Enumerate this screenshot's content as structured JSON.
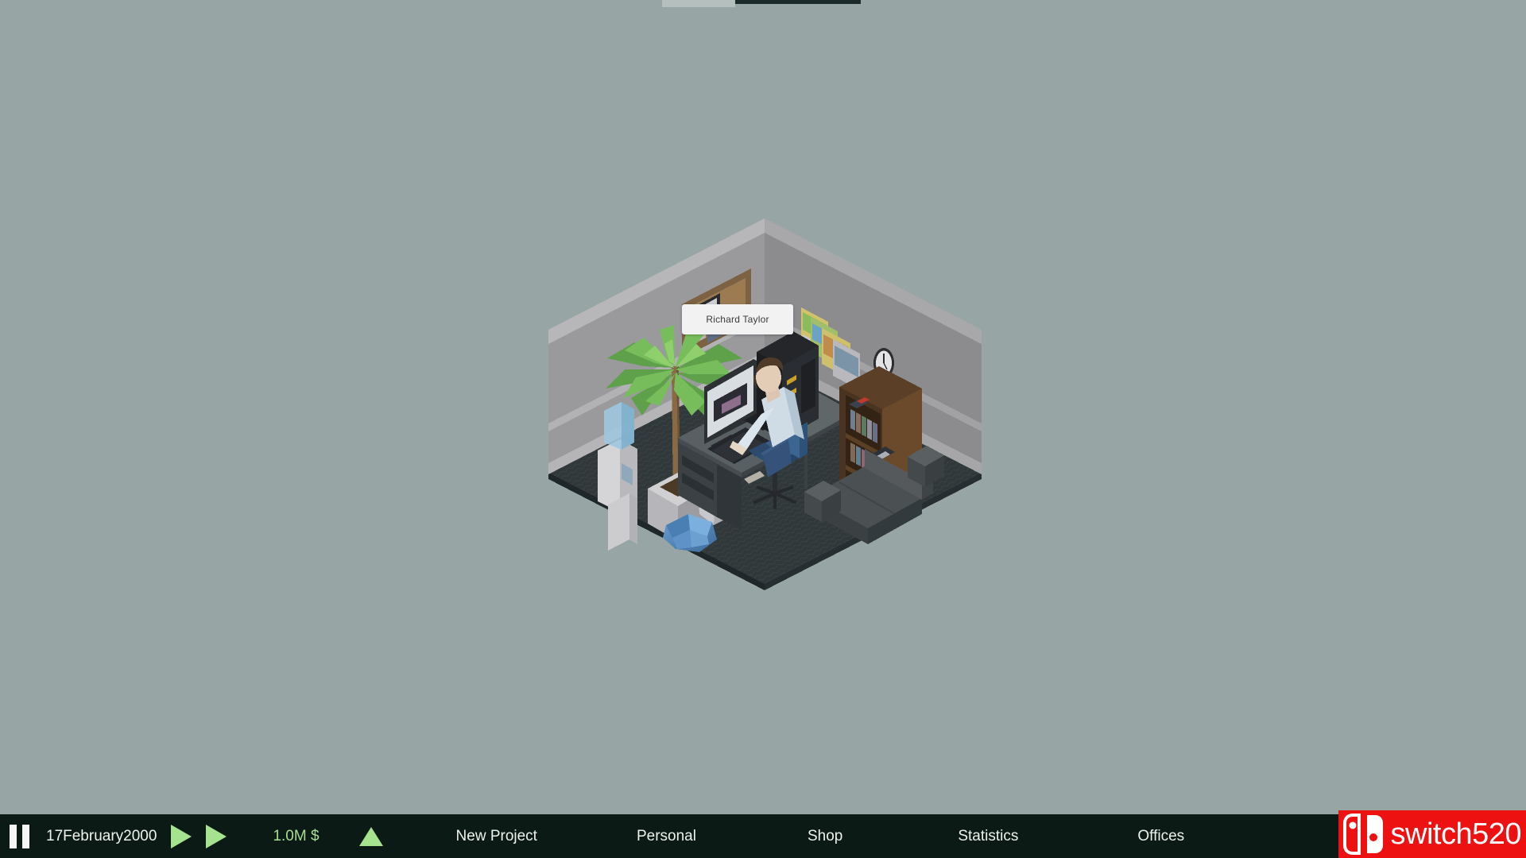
{
  "app": {
    "background_color": "#97a6a5",
    "bar_color": "#0c1a15",
    "accent_green": "#a5e38e",
    "watermark_color": "#ee1111"
  },
  "scene": {
    "tooltip": {
      "label": "Richard Taylor"
    },
    "room": {
      "wall_color": "#9b9b9e",
      "wall_shadow_color": "#8a8a8d",
      "floor_color": "#32383a",
      "trim_color": "#b9b9bc",
      "objects": [
        {
          "name": "water-cooler",
          "label": "Water Cooler"
        },
        {
          "name": "potted-palm-plant",
          "label": "Potted Plant"
        },
        {
          "name": "trash-bin",
          "label": "Trash Bin"
        },
        {
          "name": "desk",
          "label": "Desk"
        },
        {
          "name": "computer-monitor",
          "label": "Monitor"
        },
        {
          "name": "keyboard",
          "label": "Keyboard"
        },
        {
          "name": "server-rack",
          "label": "Server Rack"
        },
        {
          "name": "office-chair",
          "label": "Office Chair"
        },
        {
          "name": "employee-character",
          "label": "Richard Taylor"
        },
        {
          "name": "bookshelf",
          "label": "Bookshelf"
        },
        {
          "name": "couch",
          "label": "Couch"
        },
        {
          "name": "bean-bag",
          "label": "Bean Bag"
        },
        {
          "name": "wall-clock",
          "label": "Wall Clock"
        },
        {
          "name": "wall-posters",
          "label": "Posters"
        },
        {
          "name": "cork-board",
          "label": "Cork Board"
        }
      ]
    }
  },
  "bottom_bar": {
    "pause_icon": "pause-icon",
    "date": "17February2000",
    "play_icon": "play-icon",
    "fast_forward_icon": "fast-forward-icon",
    "money": "1.0M $",
    "trend_icon": "trend-up-icon",
    "menu": [
      {
        "id": "new-project",
        "label": "New Project"
      },
      {
        "id": "personal",
        "label": "Personal"
      },
      {
        "id": "shop",
        "label": "Shop"
      },
      {
        "id": "statistics",
        "label": "Statistics"
      },
      {
        "id": "offices",
        "label": "Offices"
      }
    ]
  },
  "watermark": {
    "text": "switch520",
    "icon": "nintendo-switch-icon"
  }
}
